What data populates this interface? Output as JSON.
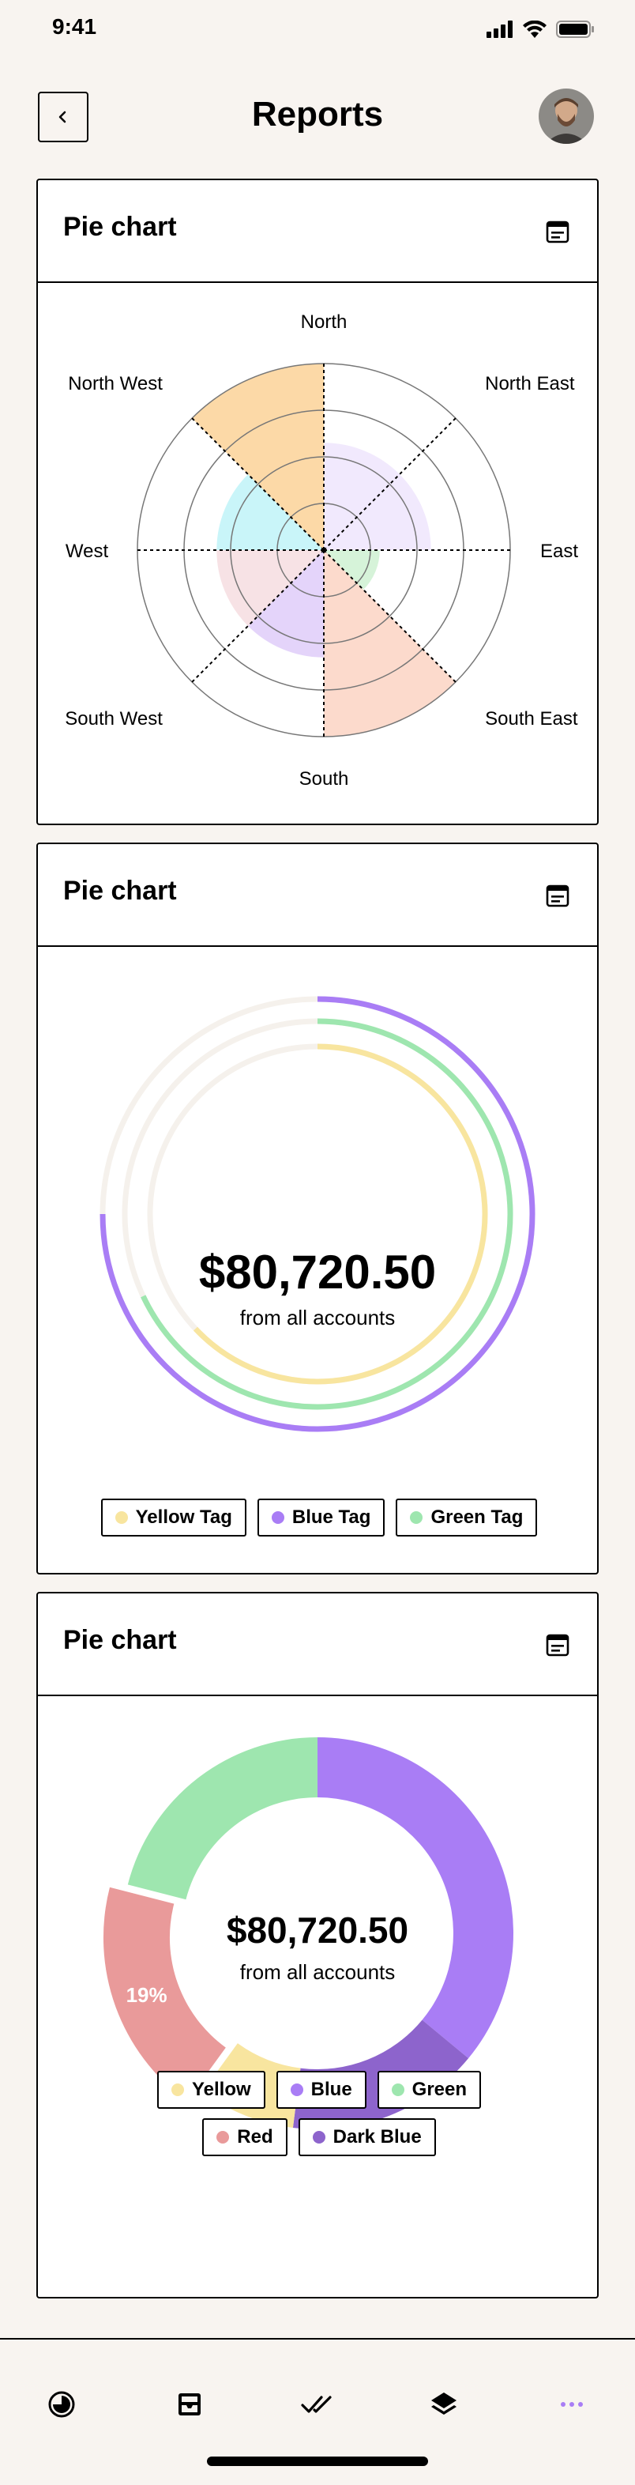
{
  "status": {
    "time": "9:41"
  },
  "header": {
    "title": "Reports"
  },
  "polar_card": {
    "title": "Pie chart",
    "directions": [
      "North",
      "North East",
      "East",
      "South East",
      "South",
      "South West",
      "West",
      "North West"
    ]
  },
  "rings_card": {
    "title": "Pie chart",
    "amount": "$80,720.50",
    "subtitle": "from all accounts",
    "legend": [
      {
        "label": "Yellow Tag",
        "color": "#f8e59f"
      },
      {
        "label": "Blue Tag",
        "color": "#a97df5"
      },
      {
        "label": "Green Tag",
        "color": "#9ee6af"
      }
    ]
  },
  "donut_card": {
    "title": "Pie chart",
    "amount": "$80,720.50",
    "subtitle": "from all accounts",
    "highlight_label": "19%",
    "legend_row1": [
      {
        "label": "Yellow",
        "color": "#f8e59f"
      },
      {
        "label": "Blue",
        "color": "#a97df5"
      },
      {
        "label": "Green",
        "color": "#9ee6af"
      }
    ],
    "legend_row2": [
      {
        "label": "Red",
        "color": "#e99a9a"
      },
      {
        "label": "Dark Blue",
        "color": "#8d64cc"
      }
    ]
  },
  "chart_data": [
    {
      "type": "polar-area",
      "title": "",
      "categories": [
        "North",
        "North East",
        "East",
        "South East",
        "South",
        "South West",
        "West",
        "North West"
      ],
      "values": [
        2.3,
        2.3,
        1.2,
        4.0,
        2.3,
        2.3,
        2.3,
        4.0
      ],
      "colors": [
        "#f1e9fd",
        "#f1e9fd",
        "#d6f3d9",
        "#fcdacc",
        "#e4d4fa",
        "#f7e2e5",
        "#c9f5f9",
        "#fcd9a7"
      ],
      "rings": 4,
      "grid": true
    },
    {
      "type": "radial-bar",
      "series": [
        {
          "name": "Blue Tag",
          "value": 0.75,
          "color": "#a97df5"
        },
        {
          "name": "Green Tag",
          "value": 0.68,
          "color": "#9ee6af"
        },
        {
          "name": "Yellow Tag",
          "value": 0.63,
          "color": "#f8e59f"
        }
      ],
      "unit": "fraction of full circle"
    },
    {
      "type": "pie",
      "categories": [
        "Blue",
        "Dark Blue",
        "Yellow",
        "Red",
        "Green"
      ],
      "values": [
        36,
        16,
        8,
        19,
        21
      ],
      "colors": [
        "#a97df5",
        "#8d64cc",
        "#f8e59f",
        "#e99a9a",
        "#9ee6af"
      ],
      "labels": {
        "Red": "19%"
      }
    }
  ],
  "tabbar": {
    "items": [
      "reports-icon",
      "inbox-icon",
      "done-all-icon",
      "layers-icon",
      "more-icon"
    ],
    "active": "more-icon",
    "active_color": "#a97df5"
  }
}
